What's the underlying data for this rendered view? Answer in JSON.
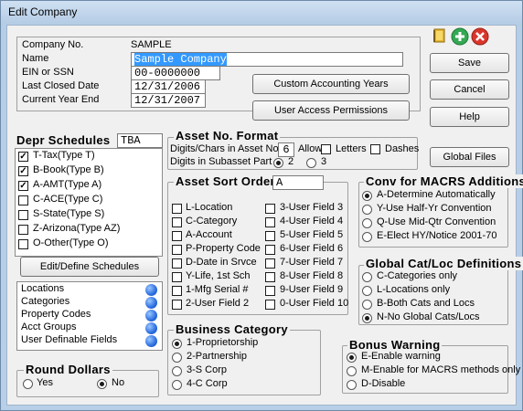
{
  "window": {
    "title": "Edit Company"
  },
  "company": {
    "no_label": "Company No.",
    "no_value": "SAMPLE",
    "name_label": "Name",
    "name_value": "Sample Company",
    "ein_label": "EIN or SSN",
    "ein_value": "00-0000000",
    "lcd_label": "Last Closed Date",
    "lcd_value": "12/31/2006",
    "cye_label": "Current Year End",
    "cye_value": "12/31/2007"
  },
  "buttons": {
    "save": "Save",
    "cancel": "Cancel",
    "help": "Help",
    "global_files": "Global Files",
    "custom_years": "Custom Accounting Years",
    "user_access": "User Access Permissions",
    "edit_schedules": "Edit/Define Schedules"
  },
  "depr": {
    "title": "Depr Schedules",
    "code": "TBA",
    "items": [
      {
        "label": "T-Tax(Type T)",
        "checked": true
      },
      {
        "label": "B-Book(Type B)",
        "checked": true
      },
      {
        "label": "A-AMT(Type A)",
        "checked": true
      },
      {
        "label": "C-ACE(Type C)",
        "checked": false
      },
      {
        "label": "S-State(Type S)",
        "checked": false
      },
      {
        "label": "Z-Arizona(Type AZ)",
        "checked": false
      },
      {
        "label": "O-Other(Type O)",
        "checked": false
      }
    ]
  },
  "links": [
    "Locations",
    "Categories",
    "Property Codes",
    "Acct Groups",
    "User Definable Fields"
  ],
  "round": {
    "title": "Round Dollars",
    "yes": "Yes",
    "no": "No",
    "selected": "no"
  },
  "assetno": {
    "title": "Asset No. Format",
    "digits_label": "Digits/Chars in Asset No.",
    "digits_value": "6",
    "allow_label": "Allow",
    "letters": "Letters",
    "dashes": "Dashes",
    "subasset_label": "Digits in Subasset Part",
    "opt2": "2",
    "opt3": "3"
  },
  "sort": {
    "title": "Asset Sort Order",
    "value": "A",
    "col1": [
      "L-Location",
      "C-Category",
      "A-Account",
      "P-Property Code",
      "D-Date in Srvce",
      "Y-Life, 1st Sch",
      "1-Mfg Serial #",
      "2-User Field 2"
    ],
    "col2": [
      "3-User Field 3",
      "4-User Field 4",
      "5-User Field 5",
      "6-User Field 6",
      "7-User Field 7",
      "8-User Field 8",
      "9-User Field 9",
      "0-User Field 10"
    ]
  },
  "macrs": {
    "title": "Conv for MACRS Additions",
    "options": [
      "A-Determine Automatically",
      "Y-Use Half-Yr Convention",
      "Q-Use Mid-Qtr Convention",
      "E-Elect HY/Notice 2001-70"
    ],
    "selected": 0
  },
  "catloc": {
    "title": "Global Cat/Loc Definitions",
    "options": [
      "C-Categories only",
      "L-Locations only",
      "B-Both Cats and Locs",
      "N-No Global Cats/Locs"
    ],
    "selected": 3
  },
  "business": {
    "title": "Business Category",
    "options": [
      "1-Proprietorship",
      "2-Partnership",
      "3-S Corp",
      "4-C Corp"
    ],
    "selected": 0
  },
  "bonus": {
    "title": "Bonus Warning",
    "options": [
      "E-Enable warning",
      "M-Enable for MACRS methods only",
      "D-Disable"
    ],
    "selected": 0
  },
  "colors": {
    "accent": "#2a6de0",
    "close": "#d9372c",
    "ok": "#34a853"
  }
}
